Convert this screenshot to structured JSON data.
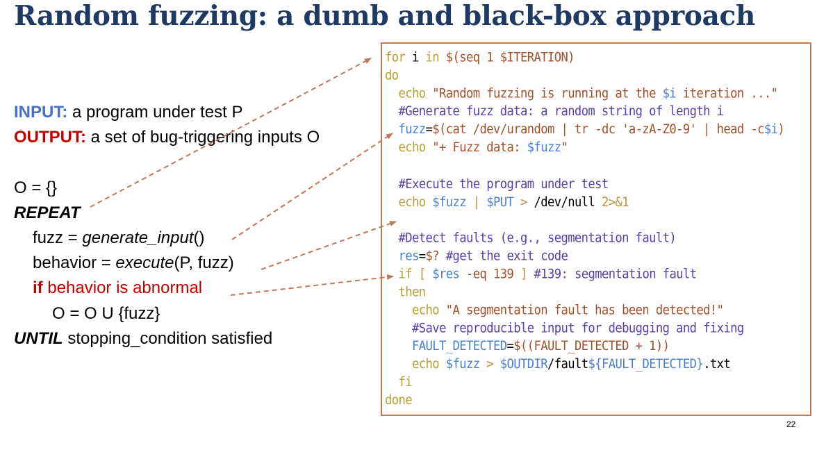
{
  "slide": {
    "title": "Random fuzzing: a dumb and black-box approach",
    "page_number": "22"
  },
  "algorithm": {
    "input_label": "INPUT:",
    "input_text": " a program under test P",
    "output_label": "OUTPUT:",
    "output_text": " a set of bug-triggering inputs O",
    "init": "O = {}",
    "repeat": "REPEAT",
    "fuzz_prefix": "fuzz = ",
    "fuzz_fn": "generate_input",
    "fuzz_suffix": "()",
    "behavior_prefix": "behavior = ",
    "behavior_fn": "execute",
    "behavior_suffix": "(P, fuzz)",
    "if_kw": "if",
    "if_cond": " behavior is abnormal",
    "union": "O = O U {fuzz}",
    "until_kw": "UNTIL",
    "until_text": " stopping_condition satisfied"
  },
  "code": {
    "l1": {
      "a": "for",
      "b": " i ",
      "c": "in",
      "d": " $(seq 1 $ITERATION)"
    },
    "l2": {
      "a": "do"
    },
    "l3": {
      "a": "  echo ",
      "b": "\"Random fuzzing is running at the ",
      "c": "$i",
      "d": " iteration ...\""
    },
    "l4": {
      "a": "  #Generate fuzz data: a random string of length i"
    },
    "l5": {
      "a": "  fuzz",
      "b": "=",
      "c": "$(cat /dev/urandom | tr -dc ",
      "d": "'a-zA-Z0-9'",
      "e": " | head -c",
      "f": "$i",
      "g": ")"
    },
    "l6": {
      "a": "  echo ",
      "b": "\"+ Fuzz data: ",
      "c": "$fuzz",
      "d": "\""
    },
    "l7": {
      "a": "  #Execute the program under test"
    },
    "l8": {
      "a": "  echo ",
      "b": "$fuzz",
      "c": " | ",
      "d": "$PUT",
      "e": " > ",
      "f": "/dev/null ",
      "g": "2>&1"
    },
    "l9": {
      "a": "  #Detect faults (e.g., segmentation fault)"
    },
    "l10": {
      "a": "  res",
      "b": "=",
      "c": "$?",
      "d": " #get the exit code"
    },
    "l11": {
      "a": "  if",
      "b": " [ ",
      "c": "$res",
      "d": " -eq ",
      "e": "139",
      "f": " ] ",
      "g": "#139: segmentation fault"
    },
    "l12": {
      "a": "  then"
    },
    "l13": {
      "a": "    echo ",
      "b": "\"A segmentation fault has been detected!\""
    },
    "l14": {
      "a": "    #Save reproducible input for debugging and fixing"
    },
    "l15": {
      "a": "    FAULT_DETECTED",
      "b": "=",
      "c": "$((FAULT_DETECTED + 1))"
    },
    "l16": {
      "a": "    echo ",
      "b": "$fuzz",
      "c": " > ",
      "d": "$OUTDIR",
      "e": "/fault",
      "f": "${FAULT_DETECTED}",
      "g": ".txt"
    },
    "l17": {
      "a": "  fi"
    },
    "l18": {
      "a": "done"
    }
  },
  "colors": {
    "title": "#1f3864",
    "input_label": "#4472c4",
    "output_label": "#c00000",
    "arrow": "#c0785a",
    "border": "#c0785a"
  }
}
